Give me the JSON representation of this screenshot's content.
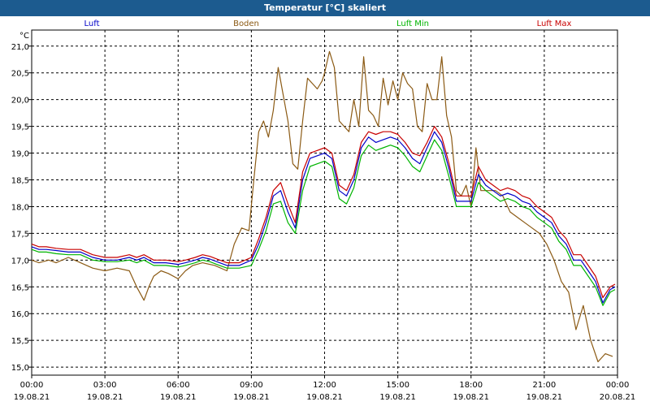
{
  "window": {
    "title": "Temperatur [°C] skaliert"
  },
  "colors": {
    "titlebar": "#1c5b8f",
    "luft": "#0000c8",
    "boden": "#8b5a14",
    "luft_min": "#00b400",
    "luft_max": "#c80000",
    "grid": "#000000"
  },
  "chart_data": {
    "type": "line",
    "title": "Temperatur [°C] skaliert",
    "ylabel": "°C",
    "ylim": [
      14.85,
      21.3
    ],
    "yticks": [
      "15,0",
      "15,5",
      "16,0",
      "16,5",
      "17,0",
      "17,5",
      "18,0",
      "18,5",
      "19,0",
      "19,5",
      "20,0",
      "20,5",
      "21,0"
    ],
    "ytick_values": [
      15.0,
      15.5,
      16.0,
      16.5,
      17.0,
      17.5,
      18.0,
      18.5,
      19.0,
      19.5,
      20.0,
      20.5,
      21.0
    ],
    "xlim": [
      0,
      24
    ],
    "xticks": [
      {
        "h": 0,
        "time": "00:00",
        "date": "19.08.21"
      },
      {
        "h": 3,
        "time": "03:00",
        "date": "19.08.21"
      },
      {
        "h": 6,
        "time": "06:00",
        "date": "19.08.21"
      },
      {
        "h": 9,
        "time": "09:00",
        "date": "19.08.21"
      },
      {
        "h": 12,
        "time": "12:00",
        "date": "19.08.21"
      },
      {
        "h": 15,
        "time": "15:00",
        "date": "19.08.21"
      },
      {
        "h": 18,
        "time": "18:00",
        "date": "19.08.21"
      },
      {
        "h": 21,
        "time": "21:00",
        "date": "19.08.21"
      },
      {
        "h": 24,
        "time": "00:00",
        "date": "20.08.21"
      }
    ],
    "grid": true,
    "legend_placement": "top",
    "series": [
      {
        "name": "Luft",
        "color": "#0000c8",
        "x": [
          0,
          0.3,
          0.6,
          1,
          1.5,
          2,
          2.5,
          3,
          3.5,
          4,
          4.3,
          4.6,
          5,
          5.5,
          6,
          6.3,
          6.7,
          7,
          7.3,
          7.7,
          8,
          8.5,
          9,
          9.3,
          9.6,
          9.9,
          10.2,
          10.5,
          10.8,
          11.1,
          11.4,
          11.7,
          12,
          12.3,
          12.6,
          12.9,
          13.2,
          13.5,
          13.8,
          14.1,
          14.4,
          14.7,
          15,
          15.3,
          15.6,
          15.9,
          16.2,
          16.5,
          16.8,
          17.1,
          17.4,
          17.7,
          18,
          18.3,
          18.6,
          18.9,
          19.2,
          19.5,
          19.8,
          20.1,
          20.4,
          20.7,
          21,
          21.3,
          21.6,
          21.9,
          22.2,
          22.5,
          22.8,
          23.1,
          23.4,
          23.7,
          23.9
        ],
        "y": [
          17.25,
          17.2,
          17.2,
          17.18,
          17.15,
          17.15,
          17.05,
          17.0,
          17.0,
          17.05,
          17.0,
          17.05,
          16.95,
          16.95,
          16.92,
          16.95,
          17.0,
          17.05,
          17.02,
          16.95,
          16.9,
          16.9,
          17.0,
          17.3,
          17.7,
          18.2,
          18.3,
          17.9,
          17.6,
          18.5,
          18.9,
          18.95,
          19.0,
          18.9,
          18.3,
          18.2,
          18.5,
          19.1,
          19.3,
          19.2,
          19.25,
          19.3,
          19.25,
          19.1,
          18.9,
          18.8,
          19.1,
          19.4,
          19.2,
          18.7,
          18.1,
          18.1,
          18.1,
          18.6,
          18.4,
          18.3,
          18.2,
          18.25,
          18.2,
          18.1,
          18.05,
          17.9,
          17.8,
          17.7,
          17.45,
          17.3,
          17.0,
          17.0,
          16.8,
          16.6,
          16.2,
          16.45,
          16.5
        ]
      },
      {
        "name": "Boden",
        "color": "#8b5a14",
        "x": [
          0,
          0.3,
          0.7,
          1,
          1.5,
          2,
          2.5,
          3,
          3.5,
          4,
          4.3,
          4.6,
          4.8,
          5,
          5.3,
          5.6,
          6,
          6.3,
          6.6,
          7,
          7.5,
          8,
          8.3,
          8.6,
          8.9,
          9.1,
          9.3,
          9.5,
          9.7,
          9.9,
          10.1,
          10.3,
          10.5,
          10.7,
          10.9,
          11.1,
          11.3,
          11.5,
          11.7,
          11.9,
          12,
          12.2,
          12.4,
          12.6,
          12.8,
          13,
          13.2,
          13.4,
          13.6,
          13.8,
          14,
          14.2,
          14.4,
          14.6,
          14.8,
          15,
          15.2,
          15.4,
          15.6,
          15.8,
          16,
          16.2,
          16.4,
          16.6,
          16.8,
          17,
          17.2,
          17.4,
          17.6,
          17.8,
          18,
          18.2,
          18.4,
          18.7,
          19,
          19.3,
          19.6,
          19.9,
          20.2,
          20.5,
          20.8,
          21.1,
          21.4,
          21.7,
          22,
          22.3,
          22.6,
          22.9,
          23.2,
          23.5,
          23.8
        ],
        "y": [
          17.0,
          16.95,
          17.0,
          16.95,
          17.05,
          16.95,
          16.85,
          16.8,
          16.85,
          16.8,
          16.5,
          16.25,
          16.5,
          16.7,
          16.8,
          16.75,
          16.65,
          16.8,
          16.9,
          16.95,
          16.9,
          16.8,
          17.3,
          17.6,
          17.55,
          18.5,
          19.4,
          19.6,
          19.3,
          19.8,
          20.6,
          20.1,
          19.6,
          18.8,
          18.7,
          19.6,
          20.4,
          20.3,
          20.2,
          20.35,
          20.5,
          20.9,
          20.6,
          19.6,
          19.5,
          19.4,
          20.0,
          19.5,
          20.8,
          19.8,
          19.7,
          19.5,
          20.4,
          19.9,
          20.35,
          20.0,
          20.5,
          20.3,
          20.2,
          19.5,
          19.4,
          20.3,
          20.0,
          20.0,
          20.8,
          19.7,
          19.3,
          18.3,
          18.2,
          18.4,
          18.0,
          19.1,
          18.3,
          18.3,
          18.3,
          18.2,
          17.9,
          17.8,
          17.7,
          17.6,
          17.5,
          17.3,
          17.0,
          16.6,
          16.4,
          15.7,
          16.15,
          15.5,
          15.1,
          15.25,
          15.2
        ]
      },
      {
        "name": "Luft Min",
        "color": "#00b400",
        "x": [
          0,
          0.3,
          0.6,
          1,
          1.5,
          2,
          2.5,
          3,
          3.5,
          4,
          4.3,
          4.6,
          5,
          5.5,
          6,
          6.3,
          6.7,
          7,
          7.3,
          7.7,
          8,
          8.5,
          9,
          9.3,
          9.6,
          9.9,
          10.2,
          10.5,
          10.8,
          11.1,
          11.4,
          11.7,
          12,
          12.3,
          12.6,
          12.9,
          13.2,
          13.5,
          13.8,
          14.1,
          14.4,
          14.7,
          15,
          15.3,
          15.6,
          15.9,
          16.2,
          16.5,
          16.8,
          17.1,
          17.4,
          17.7,
          18,
          18.3,
          18.6,
          18.9,
          19.2,
          19.5,
          19.8,
          20.1,
          20.4,
          20.7,
          21,
          21.3,
          21.6,
          21.9,
          22.2,
          22.5,
          22.8,
          23.1,
          23.4,
          23.7,
          23.9
        ],
        "y": [
          17.2,
          17.15,
          17.15,
          17.12,
          17.1,
          17.1,
          17.0,
          16.97,
          16.97,
          17.0,
          16.95,
          17.0,
          16.9,
          16.9,
          16.87,
          16.9,
          16.95,
          17.0,
          16.97,
          16.9,
          16.85,
          16.85,
          16.9,
          17.2,
          17.55,
          18.05,
          18.1,
          17.7,
          17.5,
          18.3,
          18.75,
          18.8,
          18.85,
          18.75,
          18.15,
          18.05,
          18.35,
          18.95,
          19.15,
          19.05,
          19.1,
          19.15,
          19.1,
          18.95,
          18.75,
          18.65,
          18.95,
          19.25,
          19.05,
          18.55,
          18.0,
          18.0,
          18.0,
          18.45,
          18.3,
          18.2,
          18.1,
          18.15,
          18.1,
          18.0,
          17.95,
          17.8,
          17.7,
          17.6,
          17.35,
          17.2,
          16.9,
          16.9,
          16.7,
          16.5,
          16.15,
          16.4,
          16.45
        ]
      },
      {
        "name": "Luft Max",
        "color": "#c80000",
        "x": [
          0,
          0.3,
          0.6,
          1,
          1.5,
          2,
          2.5,
          3,
          3.5,
          4,
          4.3,
          4.6,
          5,
          5.5,
          6,
          6.3,
          6.7,
          7,
          7.3,
          7.7,
          8,
          8.5,
          9,
          9.3,
          9.6,
          9.9,
          10.2,
          10.5,
          10.8,
          11.1,
          11.4,
          11.7,
          12,
          12.3,
          12.6,
          12.9,
          13.2,
          13.5,
          13.8,
          14.1,
          14.4,
          14.7,
          15,
          15.3,
          15.6,
          15.9,
          16.2,
          16.5,
          16.8,
          17.1,
          17.4,
          17.7,
          18,
          18.3,
          18.6,
          18.9,
          19.2,
          19.5,
          19.8,
          20.1,
          20.4,
          20.7,
          21,
          21.3,
          21.6,
          21.9,
          22.2,
          22.5,
          22.8,
          23.1,
          23.4,
          23.7,
          23.9
        ],
        "y": [
          17.3,
          17.25,
          17.25,
          17.22,
          17.2,
          17.2,
          17.1,
          17.05,
          17.05,
          17.1,
          17.05,
          17.1,
          17.0,
          17.0,
          16.97,
          17.0,
          17.05,
          17.1,
          17.07,
          17.0,
          16.95,
          16.95,
          17.05,
          17.4,
          17.8,
          18.3,
          18.45,
          18.05,
          17.7,
          18.65,
          19.0,
          19.05,
          19.1,
          19.0,
          18.4,
          18.3,
          18.6,
          19.2,
          19.4,
          19.35,
          19.4,
          19.4,
          19.35,
          19.2,
          19.0,
          18.95,
          19.2,
          19.5,
          19.3,
          18.8,
          18.2,
          18.2,
          18.2,
          18.75,
          18.5,
          18.4,
          18.3,
          18.35,
          18.3,
          18.2,
          18.15,
          18.0,
          17.9,
          17.8,
          17.55,
          17.4,
          17.1,
          17.1,
          16.9,
          16.7,
          16.3,
          16.5,
          16.55
        ]
      }
    ]
  }
}
